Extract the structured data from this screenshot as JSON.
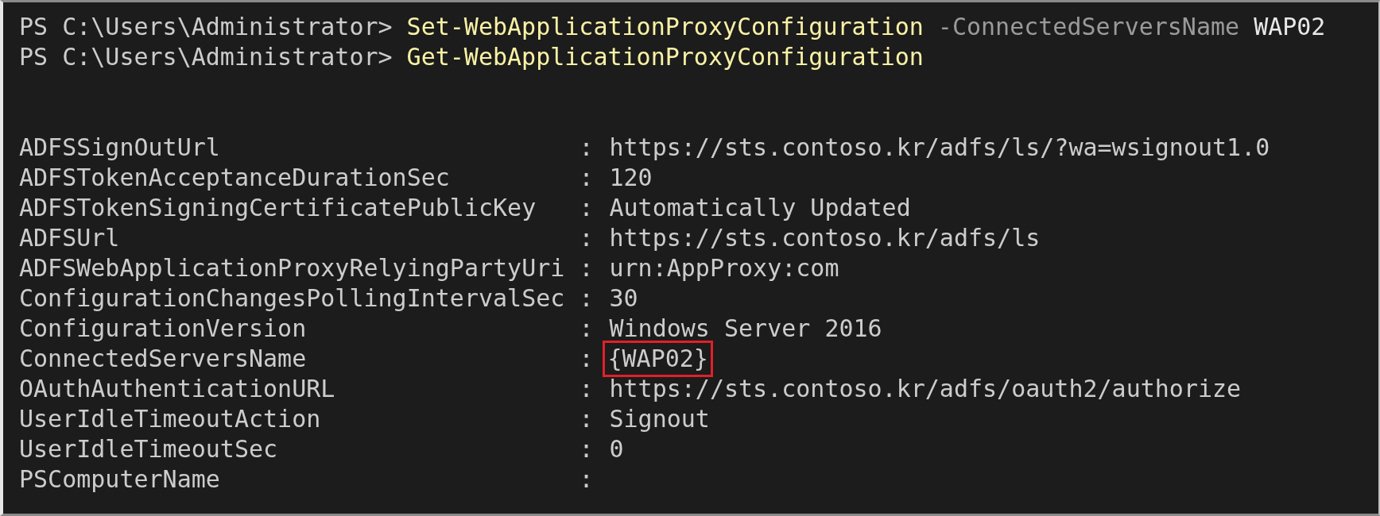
{
  "commands": [
    {
      "prompt": "PS C:\\Users\\Administrator>",
      "tokens": [
        {
          "kind": "cmdlet",
          "text": "Set-WebApplicationProxyConfiguration"
        },
        {
          "kind": "parameter",
          "text": "-ConnectedServersName"
        },
        {
          "kind": "argument",
          "text": "WAP02"
        }
      ]
    },
    {
      "prompt": "PS C:\\Users\\Administrator>",
      "tokens": [
        {
          "kind": "cmdlet",
          "text": "Get-WebApplicationProxyConfiguration"
        }
      ]
    }
  ],
  "properties": [
    {
      "name": "ADFSSignOutUrl",
      "separator": ":",
      "value": "https://sts.contoso.kr/adfs/ls/?wa=wsignout1.0"
    },
    {
      "name": "ADFSTokenAcceptanceDurationSec",
      "separator": ":",
      "value": "120"
    },
    {
      "name": "ADFSTokenSigningCertificatePublicKey",
      "separator": ":",
      "value": "Automatically Updated"
    },
    {
      "name": "ADFSUrl",
      "separator": ":",
      "value": "https://sts.contoso.kr/adfs/ls"
    },
    {
      "name": "ADFSWebApplicationProxyRelyingPartyUri",
      "separator": ":",
      "value": "urn:AppProxy:com"
    },
    {
      "name": "ConfigurationChangesPollingIntervalSec",
      "separator": ":",
      "value": "30"
    },
    {
      "name": "ConfigurationVersion",
      "separator": ":",
      "value": "Windows Server 2016"
    },
    {
      "name": "ConnectedServersName",
      "separator": ":",
      "value": "{WAP02}",
      "highlighted": true
    },
    {
      "name": "OAuthAuthenticationURL",
      "separator": ":",
      "value": "https://sts.contoso.kr/adfs/oauth2/authorize"
    },
    {
      "name": "UserIdleTimeoutAction",
      "separator": ":",
      "value": "Signout"
    },
    {
      "name": "UserIdleTimeoutSec",
      "separator": ":",
      "value": "0"
    },
    {
      "name": "PSComputerName",
      "separator": ":"
    }
  ]
}
